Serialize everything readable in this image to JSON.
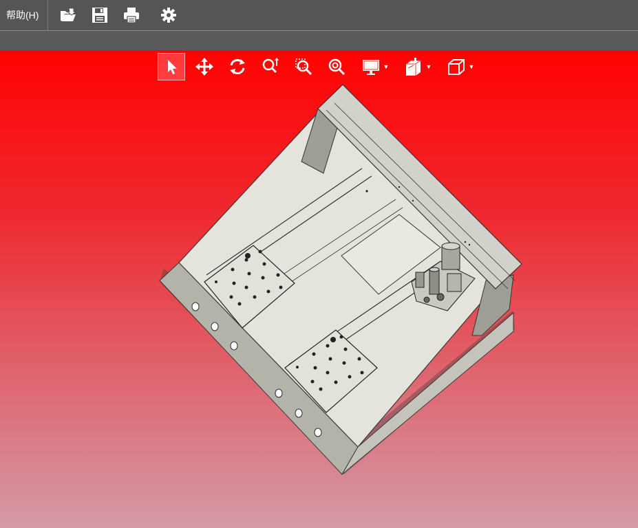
{
  "menu": {
    "help_label": "帮助(H)"
  },
  "toolbar": {
    "items": [
      {
        "icon": "open-folder-icon"
      },
      {
        "icon": "save-icon"
      },
      {
        "icon": "print-icon"
      },
      {
        "icon": "gear-icon"
      }
    ]
  },
  "view_toolbar": {
    "items": [
      {
        "icon": "select-arrow-icon",
        "active": true
      },
      {
        "icon": "pan-move-icon"
      },
      {
        "icon": "rotate-icon"
      },
      {
        "icon": "zoom-in-out-icon"
      },
      {
        "icon": "zoom-window-icon"
      },
      {
        "icon": "zoom-fit-icon"
      },
      {
        "icon": "display-monitor-icon",
        "dropdown": true
      },
      {
        "icon": "section-view-icon",
        "dropdown": true
      },
      {
        "icon": "view-cube-icon",
        "dropdown": true
      }
    ]
  },
  "viewport": {
    "background_top": "#ff0202",
    "background_bottom": "#d49aa6",
    "model_color": "#e4e4dc",
    "model_shadow": "#8f8f86"
  }
}
